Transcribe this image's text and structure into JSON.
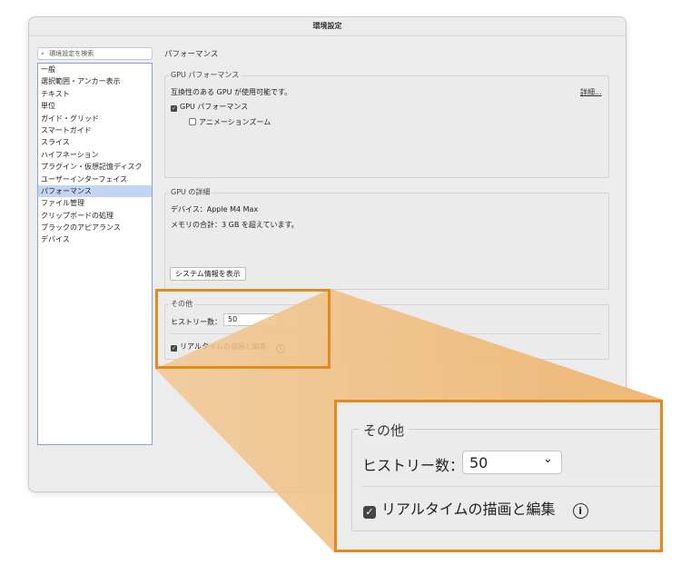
{
  "window": {
    "title": "環境設定"
  },
  "search": {
    "placeholder": "環境設定を検索",
    "icon": "search-icon"
  },
  "sidebar": {
    "items": [
      {
        "label": "一般"
      },
      {
        "label": "選択範囲・アンカー表示"
      },
      {
        "label": "テキスト"
      },
      {
        "label": "単位"
      },
      {
        "label": "ガイド・グリッド"
      },
      {
        "label": "スマートガイド"
      },
      {
        "label": "スライス"
      },
      {
        "label": "ハイフネーション"
      },
      {
        "label": "プラグイン・仮想記憶ディスク"
      },
      {
        "label": "ユーザーインターフェイス"
      },
      {
        "label": "パフォーマンス",
        "selected": true
      },
      {
        "label": "ファイル管理"
      },
      {
        "label": "クリップボードの処理"
      },
      {
        "label": "ブラックのアピアランス"
      },
      {
        "label": "デバイス"
      }
    ]
  },
  "main": {
    "heading": "パフォーマンス",
    "gpu_performance": {
      "label": "GPU パフォーマンス",
      "status": "互換性のある GPU が使用可能です。",
      "details_link": "詳細...",
      "gpu_checkbox": {
        "label": "GPU パフォーマンス",
        "checked": true
      },
      "animation_zoom": {
        "label": "アニメーションズーム",
        "checked": false
      }
    },
    "gpu_details": {
      "label": "GPU の詳細",
      "device": "デバイス：Apple M4 Max",
      "memory": "メモリの合計：3 GB を超えています。",
      "system_info_button": "システム情報を表示"
    },
    "other": {
      "label": "その他",
      "history_label": "ヒストリー数：",
      "history_value": "50",
      "realtime": {
        "label": "リアルタイムの描画と編集",
        "checked": true
      },
      "info_icon": "info-icon"
    }
  },
  "colors": {
    "highlight": "#e08b1c",
    "selection": "#c3d5f5",
    "list_border": "#7fa4d8"
  }
}
